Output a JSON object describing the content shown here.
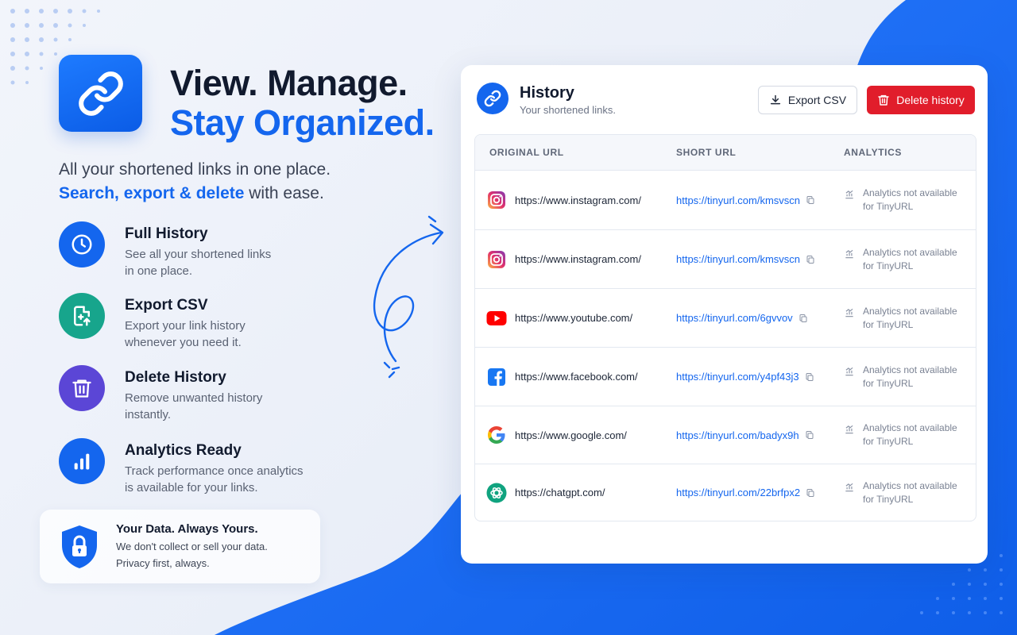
{
  "hero": {
    "title_line1": "View. Manage.",
    "title_line2": "Stay Organized.",
    "subtitle_plain1": "All your shortened links in one place.",
    "subtitle_highlight": "Search, export & delete",
    "subtitle_plain2": " with ease."
  },
  "features": [
    {
      "title": "Full History",
      "desc": "See all your shortened links\nin one place.",
      "icon": "clock-icon",
      "color": "#1466ee"
    },
    {
      "title": "Export CSV",
      "desc": "Export your link history\nwhenever you need it.",
      "icon": "file-export-icon",
      "color": "#17a58c"
    },
    {
      "title": "Delete History",
      "desc": "Remove unwanted history\ninstantly.",
      "icon": "trash-icon",
      "color": "#5b46d6"
    },
    {
      "title": "Analytics Ready",
      "desc": "Track performance once analytics\nis available for your links.",
      "icon": "bar-chart-icon",
      "color": "#1466ee"
    }
  ],
  "privacy": {
    "title": "Your Data. Always Yours.",
    "desc": "We don't collect or sell your data.\nPrivacy first, always."
  },
  "card": {
    "title": "History",
    "subtitle": "Your shortened links.",
    "export_label": "Export CSV",
    "delete_label": "Delete history",
    "columns": [
      "ORIGINAL URL",
      "SHORT URL",
      "ANALYTICS"
    ],
    "rows": [
      {
        "icon": "instagram-icon",
        "original": "https://www.instagram.com/",
        "short": "https://tinyurl.com/kmsvscn",
        "analytics_line1": "Analytics not available",
        "analytics_line2": "for TinyURL"
      },
      {
        "icon": "instagram-icon",
        "original": "https://www.instagram.com/",
        "short": "https://tinyurl.com/kmsvscn",
        "analytics_line1": "Analytics not available",
        "analytics_line2": "for TinyURL"
      },
      {
        "icon": "youtube-icon",
        "original": "https://www.youtube.com/",
        "short": "https://tinyurl.com/6gvvov",
        "analytics_line1": "Analytics not available",
        "analytics_line2": "for TinyURL"
      },
      {
        "icon": "facebook-icon",
        "original": "https://www.facebook.com/",
        "short": "https://tinyurl.com/y4pf43j3",
        "analytics_line1": "Analytics not available",
        "analytics_line2": "for TinyURL"
      },
      {
        "icon": "google-icon",
        "original": "https://www.google.com/",
        "short": "https://tinyurl.com/badyx9h",
        "analytics_line1": "Analytics not available",
        "analytics_line2": "for TinyURL"
      },
      {
        "icon": "chatgpt-icon",
        "original": "https://chatgpt.com/",
        "short": "https://tinyurl.com/22brfpx2",
        "analytics_line1": "Analytics not available",
        "analytics_line2": "for TinyURL"
      }
    ]
  },
  "colors": {
    "brand_blue": "#1466ee",
    "delete_red": "#e11d2b",
    "teal": "#17a58c",
    "purple": "#5b46d6"
  }
}
